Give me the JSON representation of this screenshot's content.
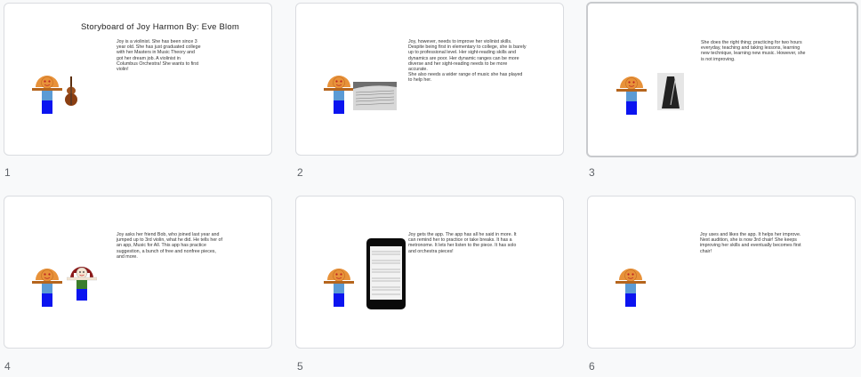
{
  "slides": [
    {
      "number": "1",
      "title": "Storyboard of Joy Harmon  By: Eve Blom",
      "text": "Joy is a violinist. She has been since 3 year old. She has just graduated college with her Masters in Music Theory and got her dream job. A violinist in Columbus Orchestra! She wants to first violin!",
      "prop": "violin-icon"
    },
    {
      "number": "2",
      "text": "Joy, however, needs to improve her violinist skills. Despite being first in elementary to college, she is barely up to professional level. Her sight-reading skills and dynamics are poor. Her dynamic ranges can be more diverse and her sight-reading needs to be more accurate.\nShe also needs a wider range of music she has played to help her.",
      "prop": "sheet-music-photo"
    },
    {
      "number": "3",
      "text": "She does the right thing; practicing for two hours everyday, teaching and taking lessons, learning new technique, learning new music. However, she is not improving.",
      "prop": "metronome-icon"
    },
    {
      "number": "4",
      "text": "Joy asks her friend Bob, who joined last year and jumped up to 3rd violin, what he did. He tells her of an app, Music for All. This app has practice suggestion, a bunch of free and nonfree pieces, and more.",
      "prop": "bob-figure"
    },
    {
      "number": "5",
      "text": "Joy gets the app. The app has all he said in more. It can remind her to practice or take breaks. It has a metronome. It lets her listen to the piece. It has solo and orchestra pieces!",
      "prop": "phone-icon"
    },
    {
      "number": "6",
      "text": "Joy uses and likes the app. It helps her improve. Next audition, she is now 3rd chair! She keeps improving her skills and eventually becomes first chair!",
      "prop": "none"
    }
  ],
  "colors": {
    "head": "#e8923a",
    "arms": "#b5651d",
    "shirt": "#5b9bd5",
    "pants": "#0b14f0",
    "bob_hair": "#8b1a1a",
    "bob_shirt": "#3a7d2c"
  }
}
